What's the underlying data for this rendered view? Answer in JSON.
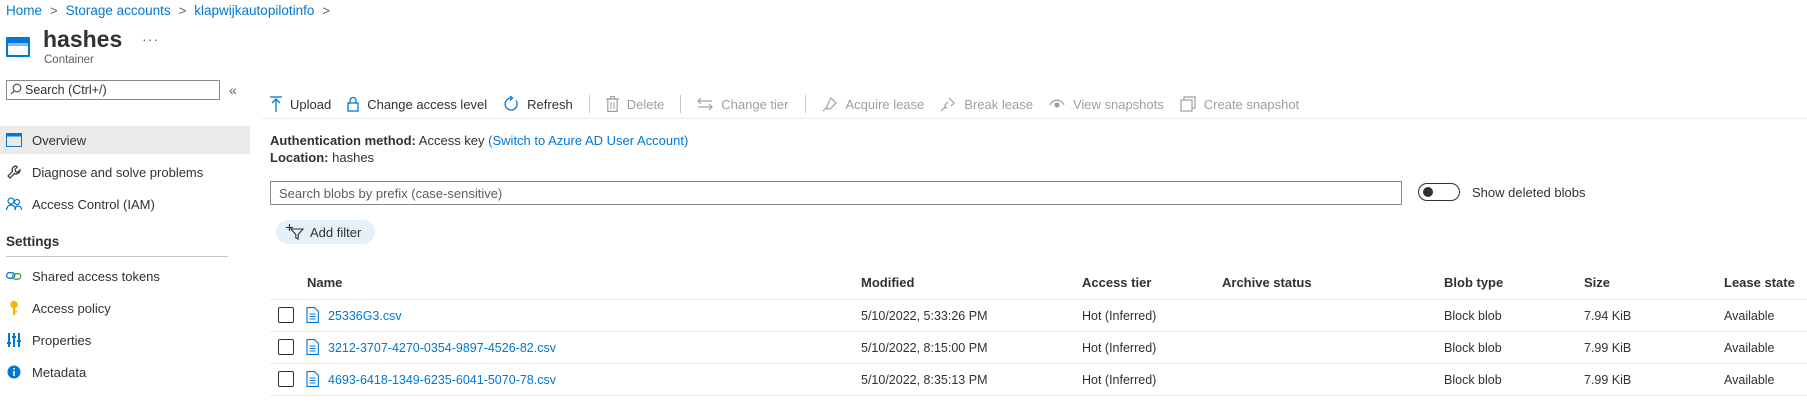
{
  "breadcrumb": {
    "items": [
      "Home",
      "Storage accounts",
      "klapwijkautopilotinfo"
    ],
    "trailing_sep": ">"
  },
  "header": {
    "title": "hashes",
    "subtitle": "Container",
    "more": "···"
  },
  "sidebar": {
    "search_placeholder": "Search (Ctrl+/)",
    "collapse": "«",
    "items": [
      {
        "label": "Overview",
        "icon": "overview-icon",
        "active": true
      },
      {
        "label": "Diagnose and solve problems",
        "icon": "wrench-icon"
      },
      {
        "label": "Access Control (IAM)",
        "icon": "people-icon"
      }
    ],
    "settings_title": "Settings",
    "settings_items": [
      {
        "label": "Shared access tokens",
        "icon": "link-icon"
      },
      {
        "label": "Access policy",
        "icon": "key-icon"
      },
      {
        "label": "Properties",
        "icon": "properties-icon"
      },
      {
        "label": "Metadata",
        "icon": "info-icon"
      }
    ]
  },
  "toolbar": {
    "upload": "Upload",
    "change_access_level": "Change access level",
    "refresh": "Refresh",
    "delete": "Delete",
    "change_tier": "Change tier",
    "acquire_lease": "Acquire lease",
    "break_lease": "Break lease",
    "view_snapshots": "View snapshots",
    "create_snapshot": "Create snapshot"
  },
  "info": {
    "auth_label": "Authentication method:",
    "auth_value": "Access key",
    "auth_link": "(Switch to Azure AD User Account)",
    "location_label": "Location:",
    "location_value": "hashes"
  },
  "blob_search": {
    "placeholder": "Search blobs by prefix (case-sensitive)"
  },
  "show_deleted": {
    "label": "Show deleted blobs",
    "on": false
  },
  "add_filter": "Add filter",
  "table": {
    "columns": [
      "Name",
      "Modified",
      "Access tier",
      "Archive status",
      "Blob type",
      "Size",
      "Lease state"
    ],
    "rows": [
      {
        "name": "25336G3.csv",
        "modified": "5/10/2022, 5:33:26 PM",
        "tier": "Hot (Inferred)",
        "archive": "",
        "type": "Block blob",
        "size": "7.94 KiB",
        "lease": "Available"
      },
      {
        "name": "3212-3707-4270-0354-9897-4526-82.csv",
        "modified": "5/10/2022, 8:15:00 PM",
        "tier": "Hot (Inferred)",
        "archive": "",
        "type": "Block blob",
        "size": "7.99 KiB",
        "lease": "Available"
      },
      {
        "name": "4693-6418-1349-6235-6041-5070-78.csv",
        "modified": "5/10/2022, 8:35:13 PM",
        "tier": "Hot (Inferred)",
        "archive": "",
        "type": "Block blob",
        "size": "7.99 KiB",
        "lease": "Available"
      }
    ]
  },
  "colors": {
    "accent": "#0078d4",
    "disabled": "#a19f9d",
    "active_bg": "#edebe9"
  }
}
